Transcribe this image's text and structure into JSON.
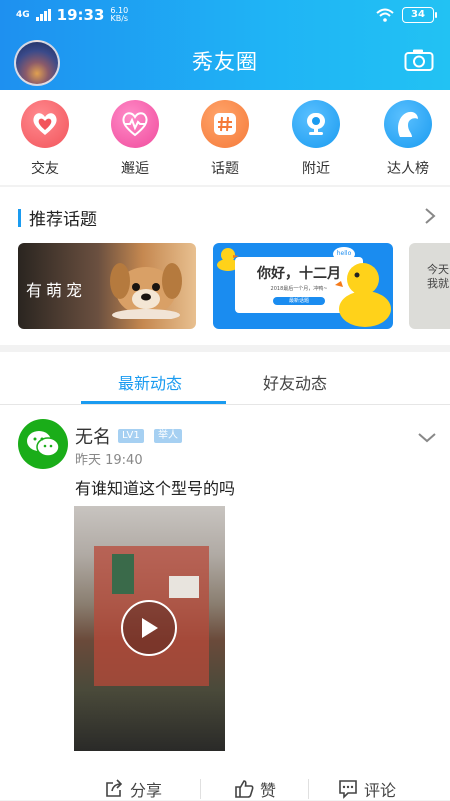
{
  "status_bar": {
    "network": "4G",
    "time": "19:33",
    "speed_value": "6.10",
    "speed_unit": "KB/s",
    "battery": "34"
  },
  "header": {
    "title": "秀友圈",
    "camera_icon": "camera-icon"
  },
  "quick_links": [
    {
      "label": "交友",
      "icon": "heart-icon",
      "color": "#f2545b"
    },
    {
      "label": "邂逅",
      "icon": "heartbeat-icon",
      "color": "#f04a9c"
    },
    {
      "label": "话题",
      "icon": "hashtag-icon",
      "color": "#f57a3a"
    },
    {
      "label": "附近",
      "icon": "location-icon",
      "color": "#1a9bf0"
    },
    {
      "label": "达人榜",
      "icon": "profile-icon",
      "color": "#1a9bf0"
    }
  ],
  "topics": {
    "title": "推荐话题",
    "cards": [
      {
        "text": "有萌宠"
      },
      {
        "big": "你好，十二月",
        "small": "2018最后一个月，冲鸭~",
        "pill": "最新话题",
        "hello": "hello"
      },
      {
        "text": "今天我就"
      }
    ]
  },
  "tabs": [
    {
      "label": "最新动态",
      "active": true
    },
    {
      "label": "好友动态",
      "active": false
    }
  ],
  "post": {
    "name": "无名",
    "level": "LV1",
    "tag": "举人",
    "time": "昨天 19:40",
    "text": "有谁知道这个型号的吗",
    "actions": [
      {
        "label": "分享",
        "icon": "share-icon"
      },
      {
        "label": "赞",
        "icon": "thumbs-up-icon"
      },
      {
        "label": "评论",
        "icon": "comment-icon"
      }
    ]
  },
  "colors": {
    "accent": "#1a9bf0",
    "header_gradient_start": "#1e90f0",
    "header_gradient_end": "#22c2f3"
  }
}
